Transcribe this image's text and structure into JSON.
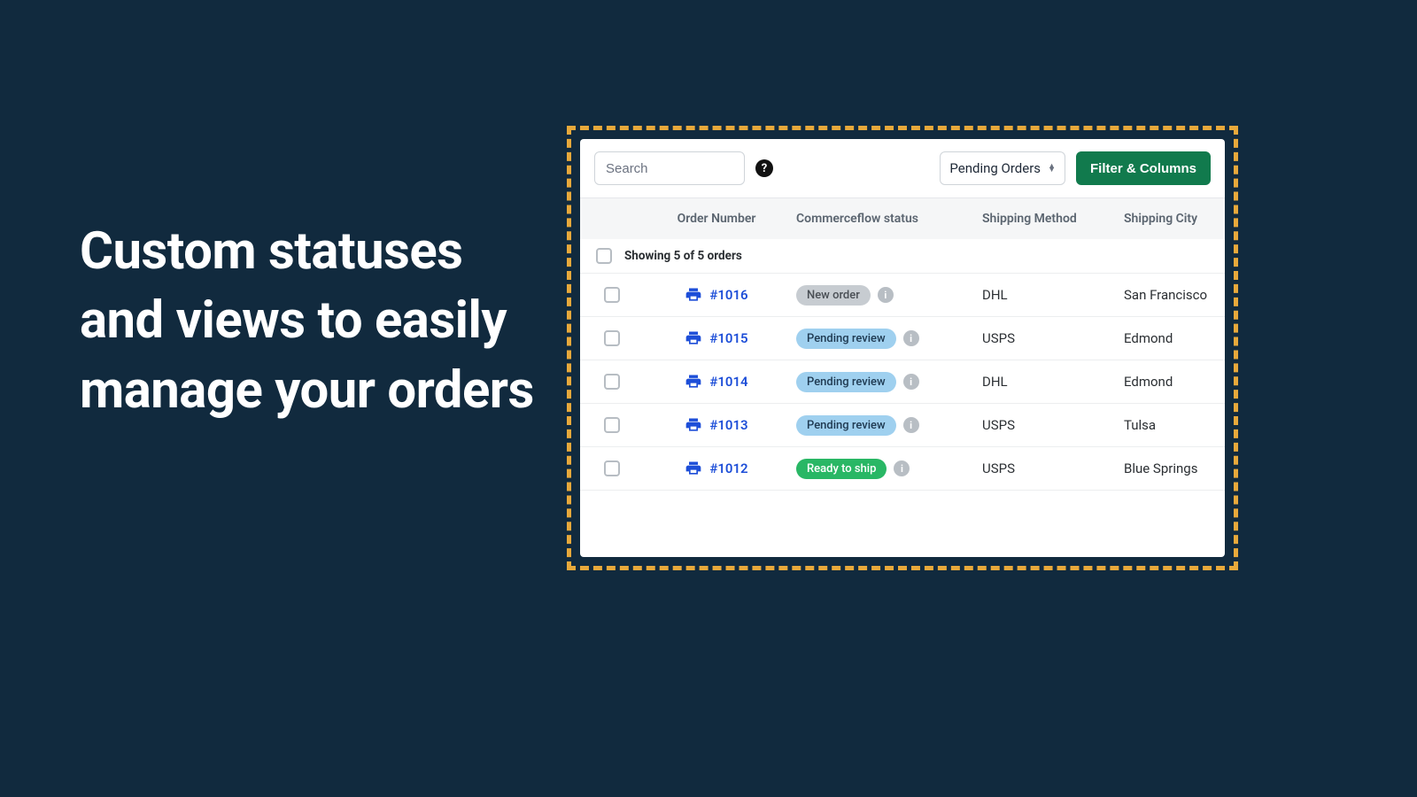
{
  "hero": {
    "headline": "Custom statuses and views to easily manage your orders"
  },
  "toolbar": {
    "search_placeholder": "Search",
    "help_glyph": "?",
    "view_selected": "Pending Orders",
    "filter_label": "Filter & Columns"
  },
  "columns": {
    "order_number": "Order Number",
    "status": "Commerceflow status",
    "shipping_method": "Shipping Method",
    "shipping_city": "Shipping City"
  },
  "summary": {
    "showing": "Showing 5 of 5 orders"
  },
  "status_styles": {
    "New order": "pill-gray",
    "Pending review": "pill-blue",
    "Ready to ship": "pill-green"
  },
  "orders": [
    {
      "number": "#1016",
      "status": "New order",
      "shipping_method": "DHL",
      "shipping_city": "San Francisco"
    },
    {
      "number": "#1015",
      "status": "Pending review",
      "shipping_method": "USPS",
      "shipping_city": "Edmond"
    },
    {
      "number": "#1014",
      "status": "Pending review",
      "shipping_method": "DHL",
      "shipping_city": "Edmond"
    },
    {
      "number": "#1013",
      "status": "Pending review",
      "shipping_method": "USPS",
      "shipping_city": "Tulsa"
    },
    {
      "number": "#1012",
      "status": "Ready to ship",
      "shipping_method": "USPS",
      "shipping_city": "Blue Springs"
    }
  ],
  "icons": {
    "info_glyph": "i"
  }
}
